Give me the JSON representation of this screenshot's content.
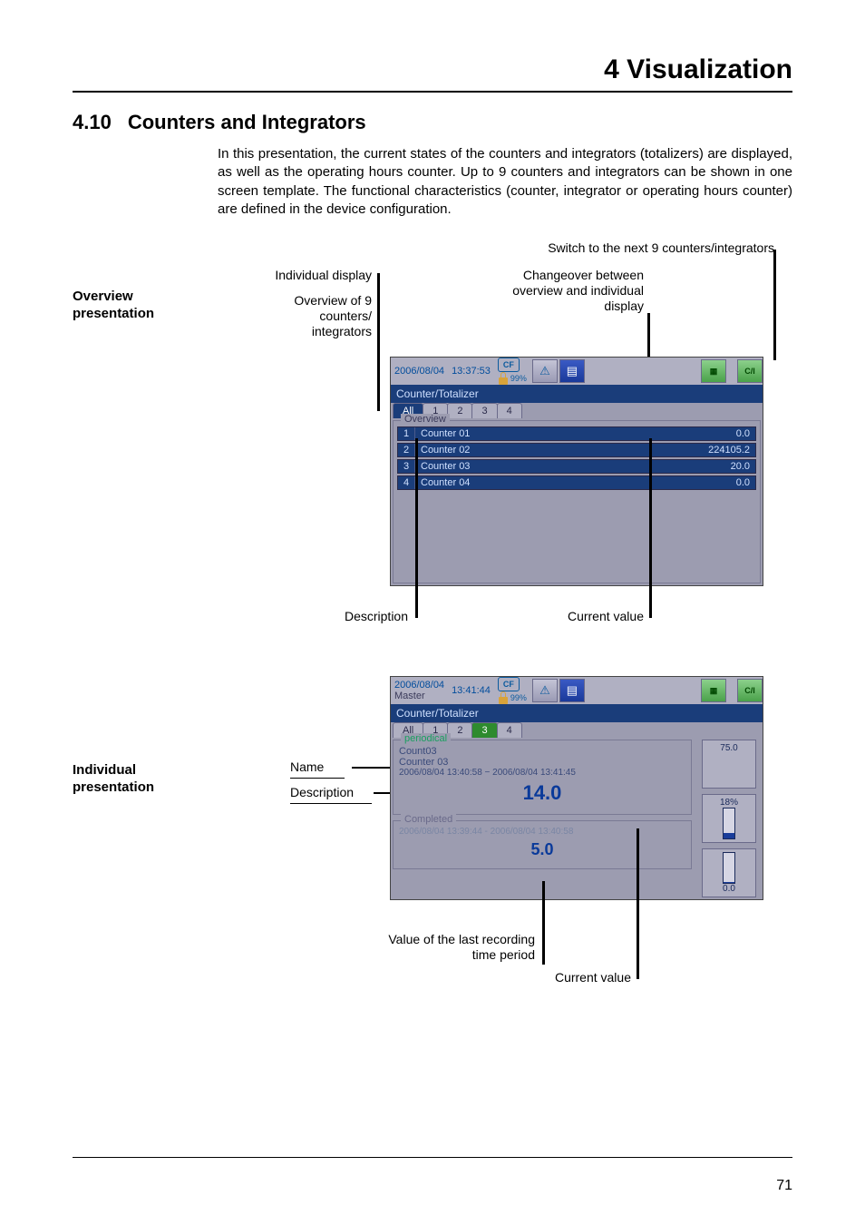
{
  "page": {
    "chapter_title": "4 Visualization",
    "section_number": "4.10",
    "section_title": "Counters and Integrators",
    "body": "In this presentation, the current states of the counters and integrators (totalizers) are displayed, as well as the operating hours counter. Up to 9 counters and integrators can be shown in one screen template. The functional characteristics (counter, integrator or operating hours counter) are defined in the device configuration.",
    "page_number": "71"
  },
  "overview": {
    "side_label_line1": "Overview",
    "side_label_line2": "presentation",
    "callouts": {
      "switch_next": "Switch to the next 9 counters/integrators",
      "individual_display": "Individual display",
      "changeover": "Changeover between overview and individual display",
      "overview_of": "Overview of 9 counters/ integrators",
      "description": "Description",
      "current_value": "Current value"
    },
    "device": {
      "date": "2006/08/04",
      "time": "13:37:53",
      "cf_label": "CF",
      "pct": "99%",
      "ci_label": "C/I",
      "titlebar": "Counter/Totalizer",
      "tabs": [
        "All",
        "1",
        "2",
        "3",
        "4"
      ],
      "selected_tab_index": 0,
      "panel_title": "Overview",
      "rows": [
        {
          "idx": "1",
          "name": "Counter 01",
          "value": "0.0"
        },
        {
          "idx": "2",
          "name": "Counter 02",
          "value": "224105.2"
        },
        {
          "idx": "3",
          "name": "Counter 03",
          "value": "20.0"
        },
        {
          "idx": "4",
          "name": "Counter 04",
          "value": "0.0"
        }
      ]
    }
  },
  "individual": {
    "side_label_line1": "Individual",
    "side_label_line2": "presentation",
    "callouts": {
      "name": "Name",
      "description": "Description",
      "value_last": "Value of the last recording time period",
      "current_value": "Current value"
    },
    "device": {
      "date": "2006/08/04",
      "time": "13:41:44",
      "subline": "Master",
      "cf_label": "CF",
      "pct": "99%",
      "ci_label": "C/I",
      "titlebar": "Counter/Totalizer",
      "tabs": [
        "All",
        "1",
        "2",
        "3",
        "4"
      ],
      "selected_tab_index": 3,
      "periodical": {
        "title": "periodical",
        "name": "Count03",
        "desc": "Counter 03",
        "range": "2006/08/04 13:40:58 − 2006/08/04 13:41:45",
        "value": "14.0"
      },
      "completed": {
        "title": "Completed",
        "range": "2006/08/04 13:39:44  -   2006/08/04 13:40:58",
        "value": "5.0"
      },
      "right": {
        "top_val": "75.0",
        "mid_pct": "18%",
        "mid_fill_pct": 18,
        "bot_val": "0.0",
        "bot_fill_pct": 2
      }
    }
  }
}
